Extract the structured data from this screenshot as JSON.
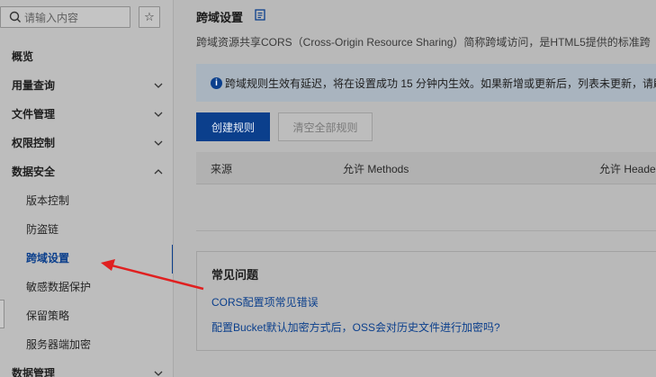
{
  "sidebar": {
    "search": {
      "placeholder": "请输入内容"
    },
    "favorite_icon": "star-icon",
    "items": [
      {
        "label": "概览",
        "expandable": false
      },
      {
        "label": "用量查询",
        "expandable": true,
        "expanded": false
      },
      {
        "label": "文件管理",
        "expandable": true,
        "expanded": false
      },
      {
        "label": "权限控制",
        "expandable": true,
        "expanded": false
      },
      {
        "label": "数据安全",
        "expandable": true,
        "expanded": true
      }
    ],
    "sub_items": [
      {
        "label": "版本控制"
      },
      {
        "label": "防盗链"
      },
      {
        "label": "跨域设置",
        "active": true
      },
      {
        "label": "敏感数据保护"
      },
      {
        "label": "保留策略"
      },
      {
        "label": "服务器端加密"
      }
    ],
    "bottom_item": {
      "label": "数据管理"
    }
  },
  "main": {
    "title": "跨域设置",
    "description": "跨域资源共享CORS（Cross-Origin Resource Sharing）简称跨域访问，是HTML5提供的标准跨",
    "notice": "跨域规则生效有延迟，将在设置成功 15 分钟内生效。如果新增或更新后，列表未更新，请刷",
    "buttons": {
      "create": "创建规则",
      "clear": "清空全部规则"
    },
    "table": {
      "headers": [
        "来源",
        "允许 Methods",
        "允许 Heade"
      ]
    },
    "faq": {
      "title": "常见问题",
      "links": [
        "CORS配置项常见错误",
        "配置Bucket默认加密方式后，OSS会对历史文件进行加密吗?"
      ]
    }
  },
  "colors": {
    "accent": "#0b3f8c",
    "annotation_arrow": "#e02020"
  }
}
